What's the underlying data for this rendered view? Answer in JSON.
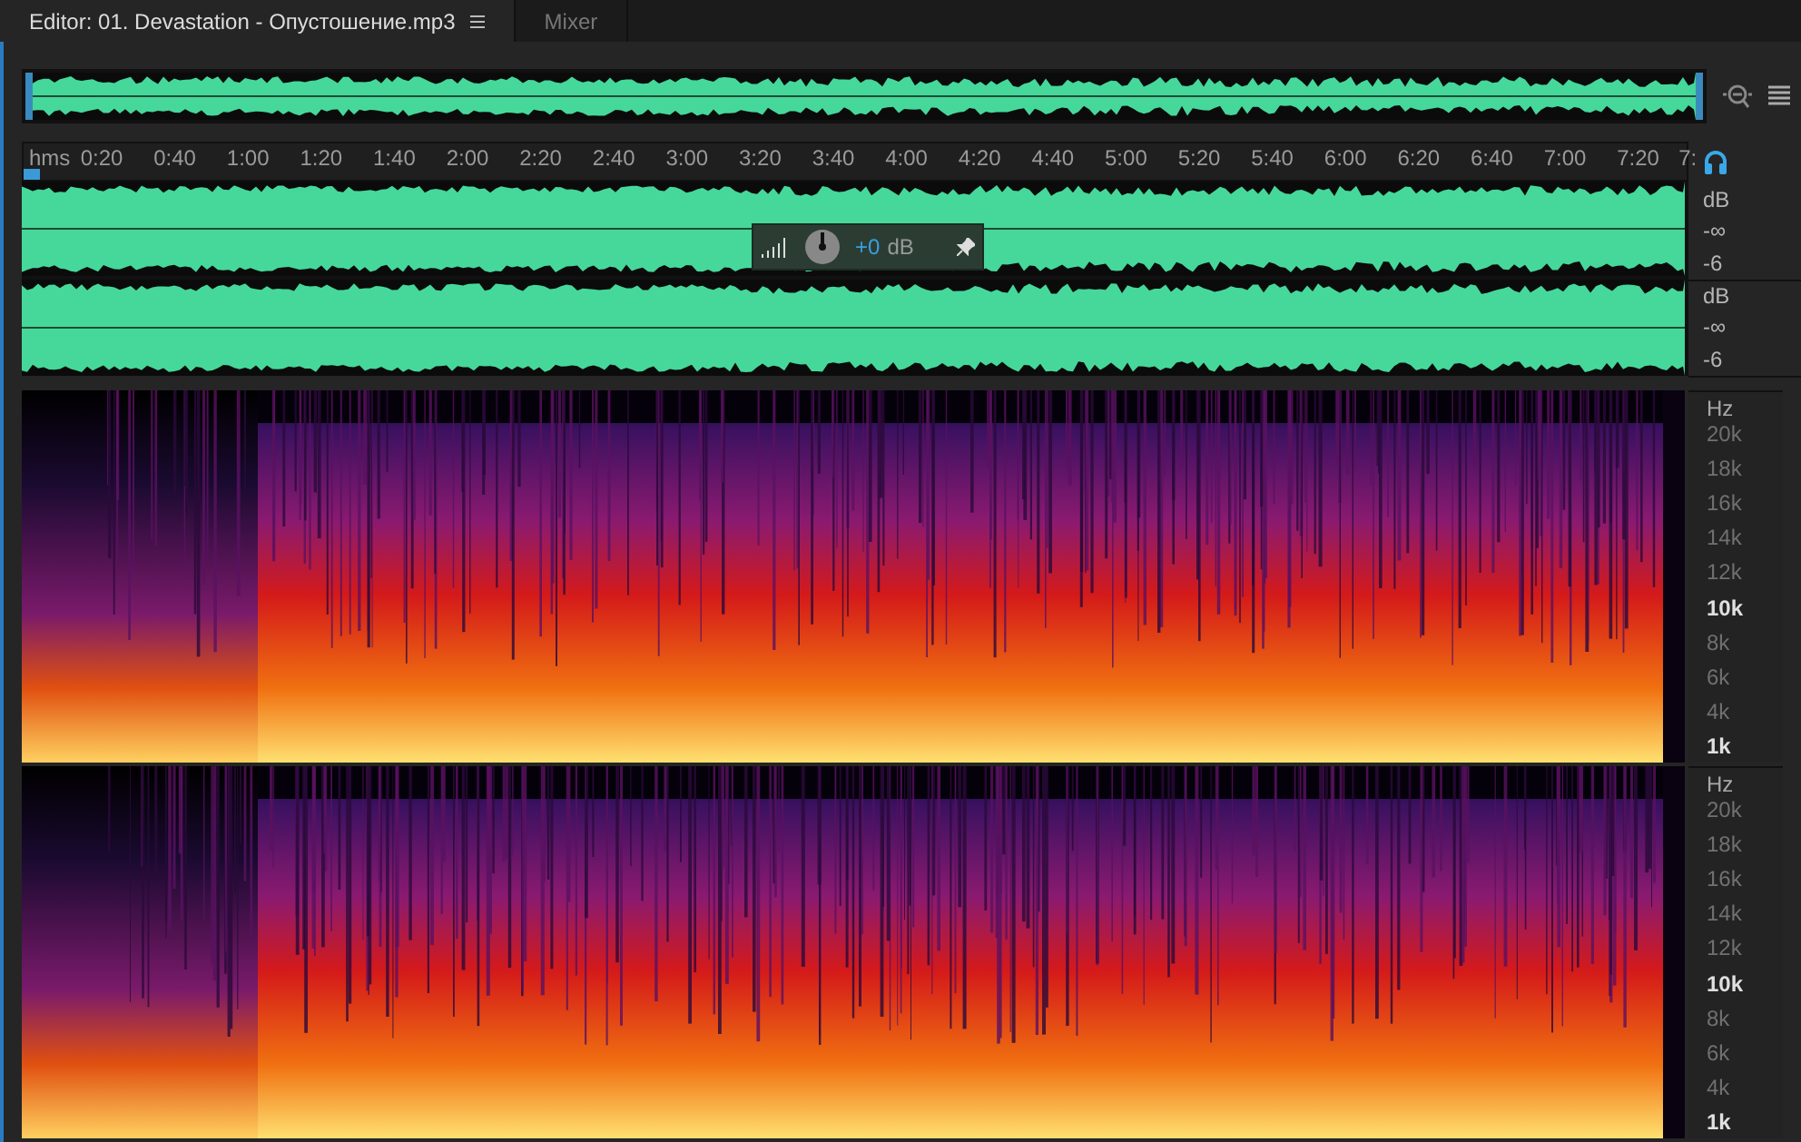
{
  "tabs": [
    {
      "label": "Editor: 01. Devastation - Опустошение.mp3",
      "selected": true
    },
    {
      "label": "Mixer",
      "selected": false
    }
  ],
  "ruler": {
    "unit": "hms",
    "ticks": [
      "0:20",
      "0:40",
      "1:00",
      "1:20",
      "1:40",
      "2:00",
      "2:20",
      "2:40",
      "3:00",
      "3:20",
      "3:40",
      "4:00",
      "4:20",
      "4:40",
      "5:00",
      "5:20",
      "5:40",
      "6:00",
      "6:20",
      "6:40",
      "7:00",
      "7:20",
      "7:"
    ]
  },
  "channels": [
    {
      "scale": [
        "dB",
        "-∞",
        "-6"
      ]
    },
    {
      "scale": [
        "dB",
        "-∞",
        "-6"
      ]
    }
  ],
  "hud": {
    "gain": "+0",
    "unit": "dB"
  },
  "spectrograms": [
    {
      "unit": "Hz",
      "labels": [
        {
          "text": "20k",
          "kind": "minor"
        },
        {
          "text": "18k",
          "kind": "minor"
        },
        {
          "text": "16k",
          "kind": "minor"
        },
        {
          "text": "14k",
          "kind": "minor"
        },
        {
          "text": "12k",
          "kind": "minor"
        },
        {
          "text": "10k",
          "kind": "major"
        },
        {
          "text": "8k",
          "kind": "minor"
        },
        {
          "text": "6k",
          "kind": "minor"
        },
        {
          "text": "4k",
          "kind": "minor"
        },
        {
          "text": "1k",
          "kind": "major"
        }
      ]
    },
    {
      "unit": "Hz",
      "labels": [
        {
          "text": "20k",
          "kind": "minor"
        },
        {
          "text": "18k",
          "kind": "minor"
        },
        {
          "text": "16k",
          "kind": "minor"
        },
        {
          "text": "14k",
          "kind": "minor"
        },
        {
          "text": "12k",
          "kind": "minor"
        },
        {
          "text": "10k",
          "kind": "major"
        },
        {
          "text": "8k",
          "kind": "minor"
        },
        {
          "text": "6k",
          "kind": "minor"
        },
        {
          "text": "4k",
          "kind": "minor"
        },
        {
          "text": "1k",
          "kind": "major"
        }
      ]
    }
  ]
}
